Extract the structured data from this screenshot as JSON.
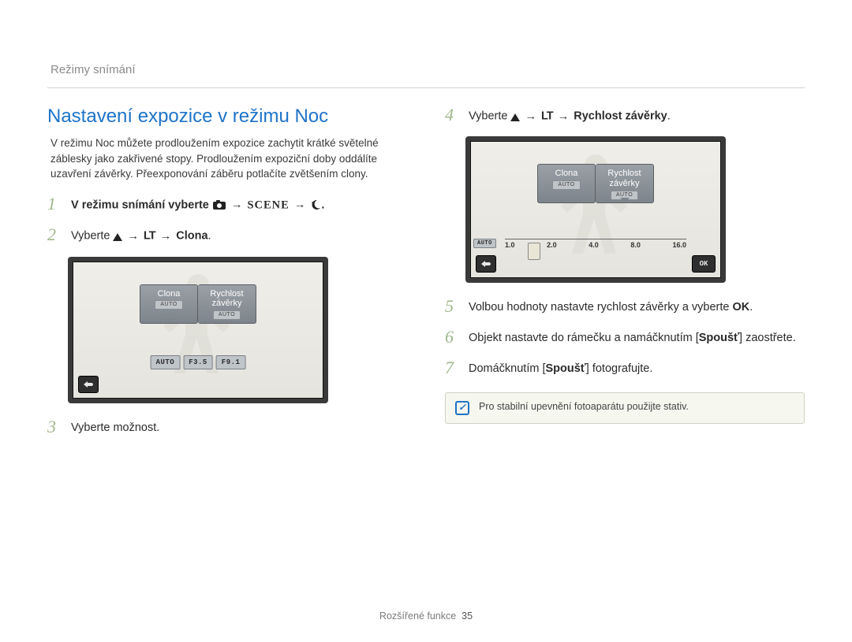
{
  "header": {
    "section": "Režimy snímání"
  },
  "heading": "Nastavení expozice v režimu Noc",
  "intro": "V režimu Noc můžete prodloužením expozice zachytit krátké světelné záblesky jako zakřivené stopy. Prodloužením expoziční doby oddálíte uzavření závěrky. Přeexponování záběru potlačíte zvětšením clony.",
  "steps_left": {
    "s1": {
      "num": "1",
      "pre": "V režimu snímání vyberte ",
      "icon1": "camera-icon",
      "arrow1": "→",
      "icon2": "scene-glyph",
      "scene_text": "SCENE",
      "arrow2": "→",
      "icon3": "night-icon",
      "dot": "."
    },
    "s2": {
      "num": "2",
      "pre": "Vyberte ",
      "icon1": "up-triangle",
      "arrow1": "→",
      "lt": "LT",
      "arrow2": "→",
      "bold": "Clona",
      "dot": "."
    },
    "s3": {
      "num": "3",
      "text": "Vyberte možnost."
    }
  },
  "steps_right": {
    "s4": {
      "num": "4",
      "pre": "Vyberte ",
      "icon1": "up-triangle",
      "arrow1": "→",
      "lt": "LT",
      "arrow2": "→",
      "bold": "Rychlost závěrky",
      "dot": "."
    },
    "s5": {
      "num": "5",
      "pre": "Volbou hodnoty nastavte rychlost závěrky a vyberte ",
      "ok": "OK",
      "dot": "."
    },
    "s6": {
      "num": "6",
      "pre": "Objekt nastavte do rámečku a namáčknutím [",
      "bold": "Spoušť",
      "post": "] zaostřete."
    },
    "s7": {
      "num": "7",
      "pre": "Domáčknutím [",
      "bold": "Spoušť",
      "post": "] fotografujte."
    }
  },
  "lcd1": {
    "tab1": "Clona",
    "tab2_line1": "Rychlost",
    "tab2_line2": "závěrky",
    "auto": "AUTO",
    "val_auto": "AUTO",
    "val_f35": "F3.5",
    "val_f91": "F9.1"
  },
  "lcd2": {
    "tab1": "Clona",
    "tab2_line1": "Rychlost",
    "tab2_line2": "závěrky",
    "auto": "AUTO",
    "scale": [
      "1.0",
      "2.0",
      "4.0",
      "8.0",
      "16.0"
    ],
    "ok": "OK"
  },
  "note": {
    "text": "Pro stabilní upevnění fotoaparátu použijte stativ."
  },
  "footer": {
    "label": "Rozšířené funkce",
    "page": "35"
  }
}
